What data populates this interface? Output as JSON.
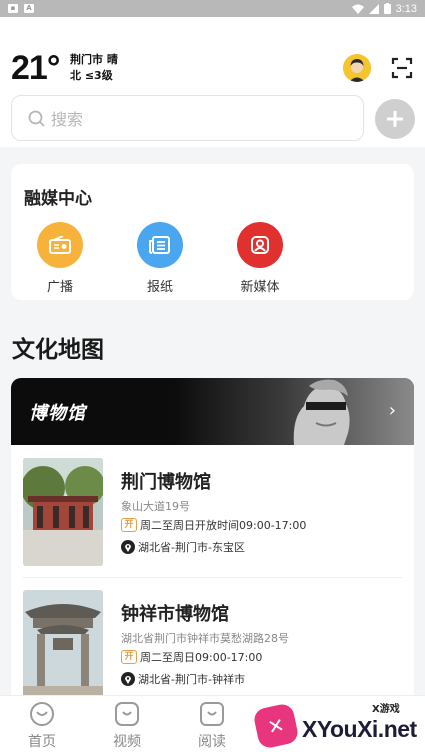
{
  "status_bar": {
    "time": "3:13",
    "left_badge": "A"
  },
  "weather": {
    "temperature": "21°",
    "city_condition": "荆门市 晴",
    "wind": "北 ≤3级"
  },
  "search": {
    "placeholder": "搜索"
  },
  "media_center": {
    "title": "融媒中心",
    "items": [
      {
        "label": "广播",
        "icon": "radio-icon",
        "color": "#f7b23b"
      },
      {
        "label": "报纸",
        "icon": "newspaper-icon",
        "color": "#4aa6ee"
      },
      {
        "label": "新媒体",
        "icon": "new-media-icon",
        "color": "#e0312e"
      }
    ]
  },
  "culture_map": {
    "title": "文化地图",
    "banner_title": "博物馆",
    "museums": [
      {
        "name": "荆门博物馆",
        "address": "象山大道19号",
        "open_tag": "开",
        "hours": "周二至周日开放时间09:00-17:00",
        "location": "湖北省-荆门市-东宝区"
      },
      {
        "name": "钟祥市博物馆",
        "address": "湖北省荆门市钟祥市莫愁湖路28号",
        "open_tag": "开",
        "hours": "周二至周日09:00-17:00",
        "location": "湖北省-荆门市-钟祥市"
      }
    ]
  },
  "tab_bar": {
    "items": [
      {
        "label": "首页",
        "icon": "home-icon"
      },
      {
        "label": "视频",
        "icon": "video-icon"
      },
      {
        "label": "阅读",
        "icon": "read-icon"
      }
    ]
  },
  "watermark": {
    "small": "X游戏",
    "main": "XYouXi.net"
  },
  "colors": {
    "accent_orange": "#e2a14a",
    "banner_bg": "#0c0c0c"
  }
}
